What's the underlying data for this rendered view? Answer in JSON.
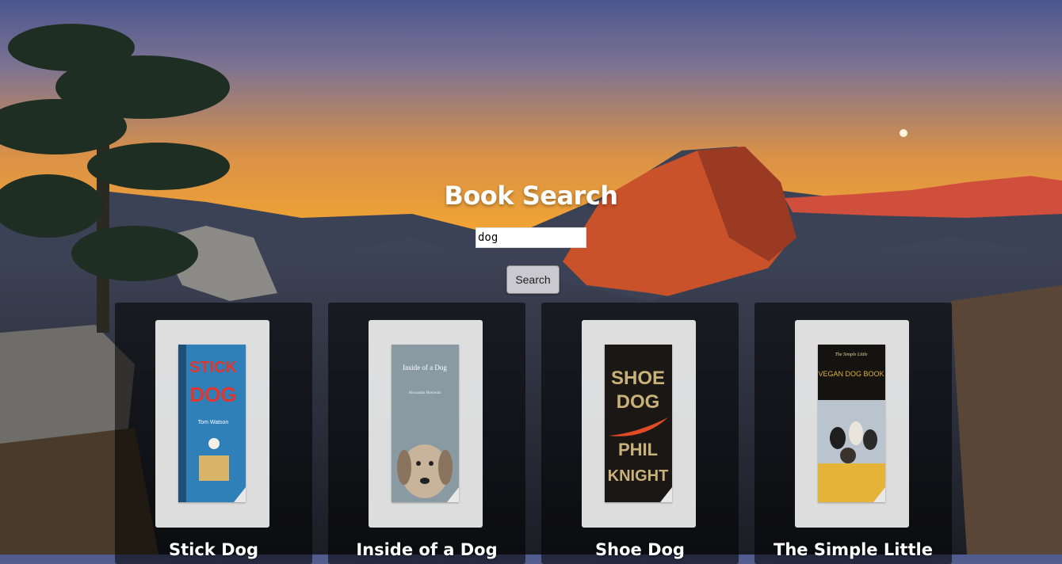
{
  "page": {
    "title": "Book Search"
  },
  "search": {
    "value": "dog",
    "button_label": "Search"
  },
  "books": [
    {
      "title": "Stick Dog",
      "cover_text": [
        "STICK",
        "DOG"
      ],
      "cover_author": "Tom Watson"
    },
    {
      "title": "Inside of a Dog",
      "cover_text": [
        "Inside of a Dog"
      ],
      "cover_author": "Alexandra Horowitz"
    },
    {
      "title": "Shoe Dog",
      "cover_text": [
        "SHOE",
        "DOG",
        "PHIL",
        "KNIGHT"
      ],
      "cover_author": ""
    },
    {
      "title": "The Simple Little",
      "cover_text": [
        "The Simple Little",
        "VEGAN DOG BOOK"
      ],
      "cover_author": ""
    }
  ],
  "colors": {
    "title": "#ffffff",
    "card_bg": "rgba(0,0,0,0.55)",
    "sky_top": "#4e5a8e",
    "sunset": "#f2a535"
  }
}
